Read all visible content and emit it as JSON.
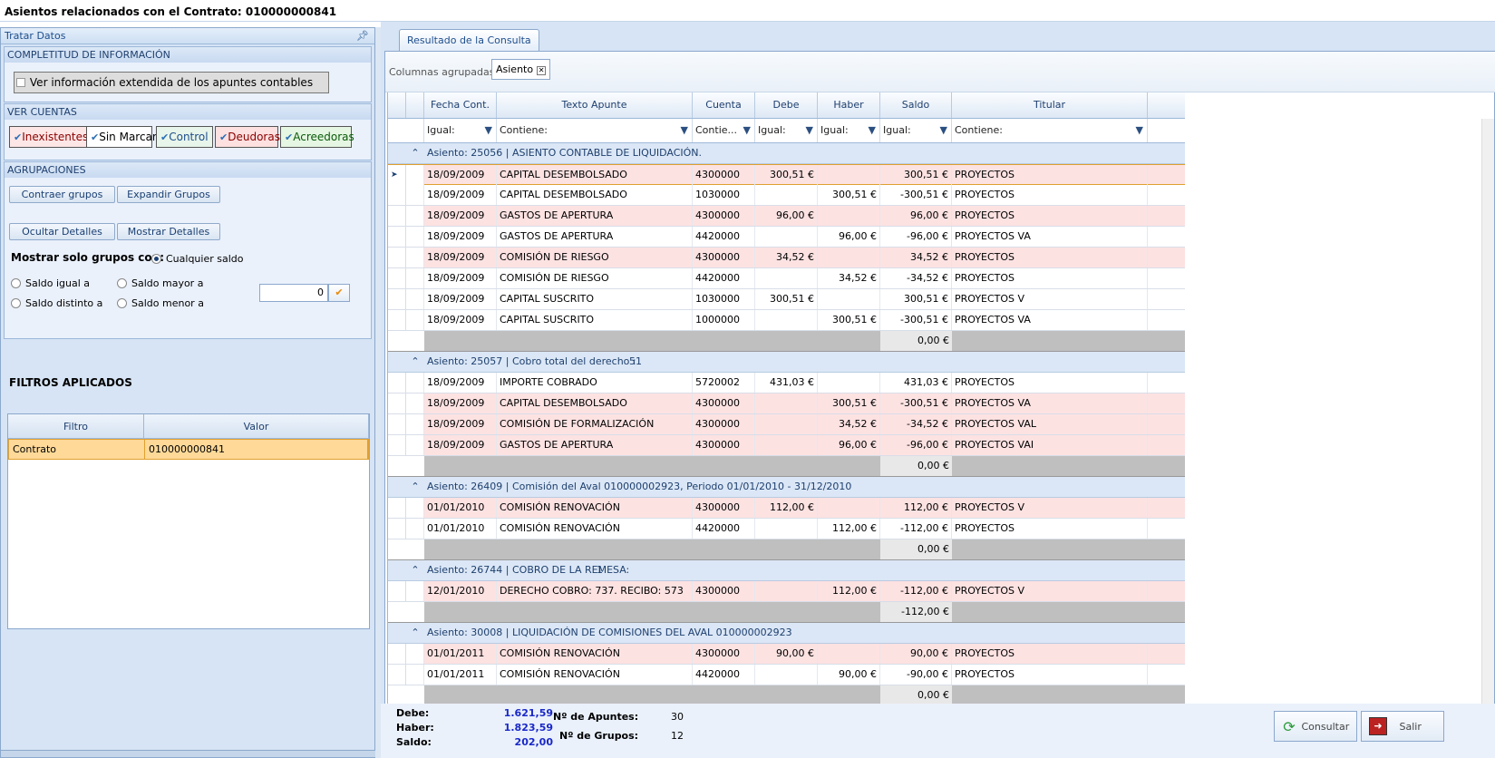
{
  "window": {
    "title": "Asientos relacionados con el Contrato: 010000000841"
  },
  "left": {
    "panel_title": "Tratar Datos",
    "completitud": {
      "title": "COMPLETITUD DE INFORMACIÓN",
      "button": "Ver información extendida de los apuntes contables"
    },
    "ver_cuentas": {
      "title": "VER CUENTAS",
      "tags": [
        {
          "label": "Inexistentes",
          "bg": "#fde6e6",
          "fg": "#8b0000"
        },
        {
          "label": "Sin Marcar",
          "bg": "#ffffff",
          "fg": "#000000"
        },
        {
          "label": "Control",
          "bg": "#e8f5ea",
          "fg": "#1e4e8c"
        },
        {
          "label": "Deudoras",
          "bg": "#fde0e0",
          "fg": "#8b0000"
        },
        {
          "label": "Acreedoras",
          "bg": "#e5f6e2",
          "fg": "#0a5a0a"
        }
      ]
    },
    "agrupaciones": {
      "title": "AGRUPACIONES",
      "contraer": "Contraer grupos",
      "expandir": "Expandir Grupos",
      "ocultar": "Ocultar Detalles",
      "mostrar": "Mostrar Detalles",
      "mostrar_solo": "Mostrar solo grupos con:",
      "cualquier": "Cualquier saldo",
      "igual": "Saldo igual a",
      "mayor": "Saldo mayor a",
      "distinto": "Saldo distinto a",
      "menor": "Saldo menor a",
      "valor": "0"
    },
    "filtros": {
      "title": "FILTROS APLICADOS",
      "col_filtro": "Filtro",
      "col_valor": "Valor",
      "row_filtro": "Contrato",
      "row_valor": "010000000841"
    }
  },
  "right": {
    "tab": "Resultado de la Consulta",
    "group_label": "Columnas agrupadas",
    "group_chip": "Asiento",
    "headers": {
      "fecha": "Fecha Cont.",
      "texto": "Texto Apunte",
      "cuenta": "Cuenta",
      "debe": "Debe",
      "haber": "Haber",
      "saldo": "Saldo",
      "titular": "Titular"
    },
    "filters": {
      "fecha": "Igual:",
      "texto": "Contiene:",
      "cuenta": "Contie...",
      "debe": "Igual:",
      "haber": "Igual:",
      "saldo": "Igual:",
      "titular": "Contiene:"
    },
    "groups": [
      {
        "title": "Asiento: 25056 | ASIENTO CONTABLE DE LIQUIDACIÓN.",
        "total": "0,00 €",
        "rows": [
          {
            "fecha": "18/09/2009",
            "texto": "CAPITAL DESEMBOLSADO",
            "cuenta": "4300000",
            "debe": "300,51 €",
            "haber": "",
            "saldo": "300,51 €",
            "titular": "PROYECTOS",
            "style": "sel"
          },
          {
            "fecha": "18/09/2009",
            "texto": "CAPITAL DESEMBOLSADO",
            "cuenta": "1030000",
            "debe": "",
            "haber": "300,51 €",
            "saldo": "-300,51 €",
            "titular": "PROYECTOS",
            "style": ""
          },
          {
            "fecha": "18/09/2009",
            "texto": "GASTOS DE APERTURA",
            "cuenta": "4300000",
            "debe": "96,00 €",
            "haber": "",
            "saldo": "96,00 €",
            "titular": "PROYECTOS",
            "style": "pink"
          },
          {
            "fecha": "18/09/2009",
            "texto": "GASTOS DE APERTURA",
            "cuenta": "4420000",
            "debe": "",
            "haber": "96,00 €",
            "saldo": "-96,00 €",
            "titular": "PROYECTOS VA",
            "style": ""
          },
          {
            "fecha": "18/09/2009",
            "texto": "COMISIÓN DE RIESGO",
            "cuenta": "4300000",
            "debe": "34,52 €",
            "haber": "",
            "saldo": "34,52 €",
            "titular": "PROYECTOS",
            "style": "pink"
          },
          {
            "fecha": "18/09/2009",
            "texto": "COMISIÓN DE RIESGO",
            "cuenta": "4420000",
            "debe": "",
            "haber": "34,52 €",
            "saldo": "-34,52 €",
            "titular": "PROYECTOS",
            "style": ""
          },
          {
            "fecha": "18/09/2009",
            "texto": "CAPITAL SUSCRITO",
            "cuenta": "1030000",
            "debe": "300,51 €",
            "haber": "",
            "saldo": "300,51 €",
            "titular": "PROYECTOS V",
            "style": ""
          },
          {
            "fecha": "18/09/2009",
            "texto": "CAPITAL SUSCRITO",
            "cuenta": "1000000",
            "debe": "",
            "haber": "300,51 €",
            "saldo": "-300,51 €",
            "titular": "PROYECTOS VA",
            "style": ""
          }
        ]
      },
      {
        "title": "Asiento: 25057 | Cobro total del derecho :",
        "title_extra": "51",
        "total": "0,00 €",
        "rows": [
          {
            "fecha": "18/09/2009",
            "texto": "IMPORTE COBRADO",
            "cuenta": "5720002",
            "debe": "431,03 €",
            "haber": "",
            "saldo": "431,03 €",
            "titular": "PROYECTOS",
            "style": ""
          },
          {
            "fecha": "18/09/2009",
            "texto": "CAPITAL DESEMBOLSADO",
            "cuenta": "4300000",
            "debe": "",
            "haber": "300,51 €",
            "saldo": "-300,51 €",
            "titular": "PROYECTOS VA",
            "style": "pink"
          },
          {
            "fecha": "18/09/2009",
            "texto": "COMISIÓN DE FORMALIZACIÓN",
            "cuenta": "4300000",
            "debe": "",
            "haber": "34,52 €",
            "saldo": "-34,52 €",
            "titular": "PROYECTOS VAL",
            "style": "pink"
          },
          {
            "fecha": "18/09/2009",
            "texto": "GASTOS DE APERTURA",
            "cuenta": "4300000",
            "debe": "",
            "haber": "96,00 €",
            "saldo": "-96,00 €",
            "titular": "PROYECTOS VAI",
            "style": "pink"
          }
        ]
      },
      {
        "title": "Asiento: 26409 | Comisión del Aval 010000002923, Periodo 01/01/2010 - 31/12/2010",
        "total": "0,00 €",
        "rows": [
          {
            "fecha": "01/01/2010",
            "texto": "COMISIÓN RENOVACIÓN",
            "cuenta": "4300000",
            "debe": "112,00 €",
            "haber": "",
            "saldo": "112,00 €",
            "titular": "PROYECTOS V",
            "style": "pink"
          },
          {
            "fecha": "01/01/2010",
            "texto": "COMISIÓN RENOVACIÓN",
            "cuenta": "4420000",
            "debe": "",
            "haber": "112,00 €",
            "saldo": "-112,00 €",
            "titular": "PROYECTOS",
            "style": ""
          }
        ]
      },
      {
        "title": "Asiento: 26744 | COBRO DE LA REMESA:",
        "title_extra": "1",
        "total": "-112,00 €",
        "rows": [
          {
            "fecha": "12/01/2010",
            "texto": "DERECHO COBRO: 737. RECIBO: 573",
            "cuenta": "4300000",
            "debe": "",
            "haber": "112,00 €",
            "saldo": "-112,00 €",
            "titular": "PROYECTOS V",
            "style": "pink"
          }
        ]
      },
      {
        "title": "Asiento: 30008 | LIQUIDACIÓN DE COMISIONES DEL AVAL 010000002923",
        "total": "0,00 €",
        "rows": [
          {
            "fecha": "01/01/2011",
            "texto": "COMISIÓN RENOVACIÓN",
            "cuenta": "4300000",
            "debe": "90,00 €",
            "haber": "",
            "saldo": "90,00 €",
            "titular": "PROYECTOS",
            "style": "pink"
          },
          {
            "fecha": "01/01/2011",
            "texto": "COMISIÓN RENOVACIÓN",
            "cuenta": "4420000",
            "debe": "",
            "haber": "90,00 €",
            "saldo": "-90,00 €",
            "titular": "PROYECTOS",
            "style": ""
          }
        ]
      }
    ],
    "footer": {
      "debe_label": "Debe:",
      "debe": "1.621,59",
      "haber_label": "Haber:",
      "haber": "1.823,59",
      "saldo_label": "Saldo:",
      "saldo": "202,00",
      "apuntes_label": "Nº de Apuntes:",
      "apuntes": "30",
      "grupos_label": "Nº de Grupos:",
      "grupos": "12",
      "consultar": "Consultar",
      "salir": "Salir"
    }
  }
}
